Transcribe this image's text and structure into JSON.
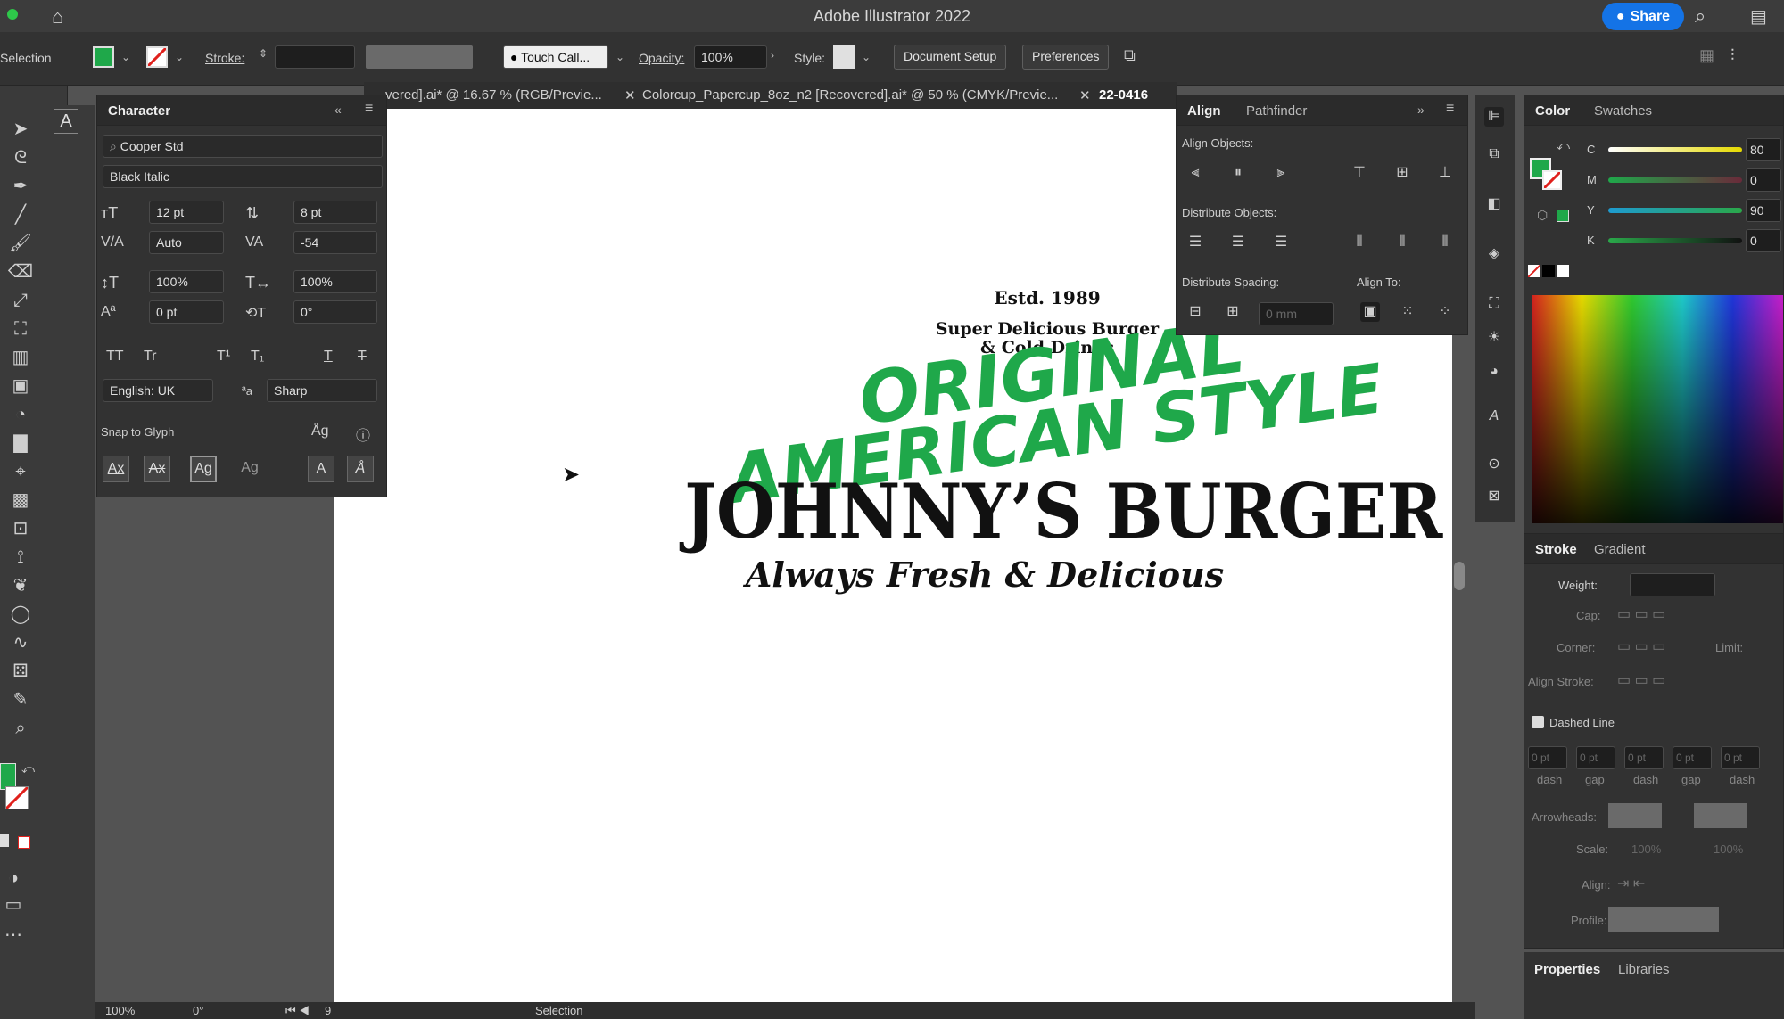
{
  "app": {
    "title": "Adobe Illustrator 2022",
    "share_label": "Share"
  },
  "control": {
    "tool_name": "Selection",
    "stroke_label": "Stroke:",
    "brush_name": "Touch Call...",
    "opacity_label": "Opacity:",
    "opacity_value": "100%",
    "style_label": "Style:",
    "doc_setup_label": "Document Setup",
    "prefs_label": "Preferences"
  },
  "tabs": [
    {
      "label": "vered].ai* @ 16.67 % (RGB/Previe..."
    },
    {
      "label": "Colorcup_Papercup_8oz_n2 [Recovered].ai* @ 50 % (CMYK/Previe..."
    },
    {
      "label": "22-0416"
    }
  ],
  "character": {
    "title": "Character",
    "font_family": "Cooper Std",
    "font_style": "Black Italic",
    "font_size": "12 pt",
    "leading": "8 pt",
    "kerning": "Auto",
    "tracking": "-54",
    "vscale": "100%",
    "hscale": "100%",
    "baseline": "0 pt",
    "rotation": "0°",
    "language": "English: UK",
    "antialias": "Sharp",
    "snap_label": "Snap to Glyph",
    "case_tt": "TT",
    "case_tr": "Tr",
    "sup": "T¹",
    "sub": "T₁"
  },
  "align": {
    "tab_align": "Align",
    "tab_pathfinder": "Pathfinder",
    "objects_label": "Align Objects:",
    "distribute_label": "Distribute Objects:",
    "spacing_label": "Distribute Spacing:",
    "align_to_label": "Align To:",
    "spacing_value": "0 mm"
  },
  "color": {
    "tab_color": "Color",
    "tab_swatches": "Swatches",
    "channels": [
      {
        "name": "C",
        "value": "80",
        "color": "#e5d900"
      },
      {
        "name": "M",
        "value": "0",
        "color": "#a0305a"
      },
      {
        "name": "Y",
        "value": "90",
        "color": "#1e9bd0"
      },
      {
        "name": "K",
        "value": "0",
        "color": "#2a8a2a"
      }
    ],
    "fill_color": "#1fa84a"
  },
  "stroke": {
    "tab_stroke": "Stroke",
    "tab_gradient": "Gradient",
    "weight_label": "Weight:",
    "cap_label": "Cap:",
    "corner_label": "Corner:",
    "limit_label": "Limit:",
    "align_stroke_label": "Align Stroke:",
    "dashed_label": "Dashed Line",
    "dash_fields": [
      {
        "value": "0 pt",
        "label": "dash"
      },
      {
        "value": "0 pt",
        "label": "gap"
      },
      {
        "value": "0 pt",
        "label": "dash"
      },
      {
        "value": "0 pt",
        "label": "gap"
      },
      {
        "value": "0 pt",
        "label": "dash"
      }
    ],
    "arrowheads_label": "Arrowheads:",
    "scale_label": "Scale:",
    "scale_a": "100%",
    "scale_b": "100%",
    "align_label": "Align:",
    "profile_label": "Profile:"
  },
  "props": {
    "tab_properties": "Properties",
    "tab_libraries": "Libraries"
  },
  "status": {
    "zoom": "100%",
    "rotate": "0°",
    "page": "9",
    "mode": "Selection"
  },
  "artwork": {
    "estd": "Estd. 1989",
    "tagline1": "Super Delicious Burger",
    "tagline2": "& Cold Drinks",
    "line1": "ORIGINAL",
    "line2": "AMERICAN STYLE",
    "brand": "JOHNNY’S BURGER",
    "slogan": "Always Fresh & Delicious"
  }
}
